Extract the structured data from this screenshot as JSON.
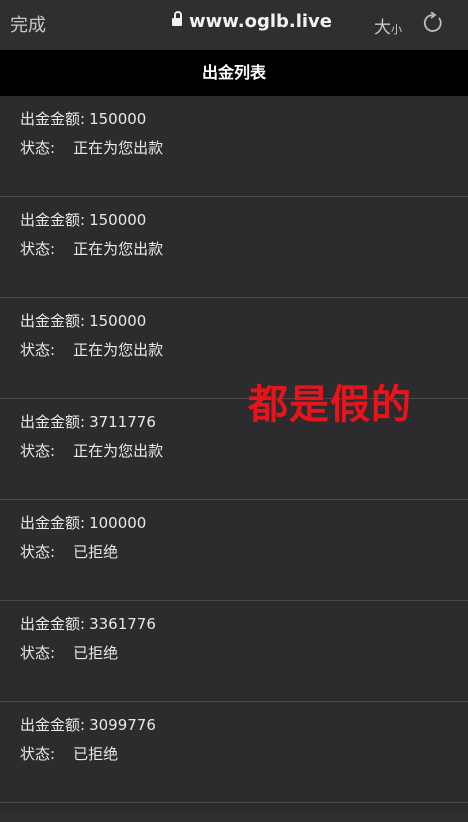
{
  "browser": {
    "done_label": "完成",
    "url": "www.oglb.live",
    "text_size_big": "大",
    "text_size_small": "小"
  },
  "page": {
    "title": "出金列表"
  },
  "list": {
    "amount_label": "出金金额:",
    "status_label": "状态:",
    "items": [
      {
        "amount": "150000",
        "status": "正在为您出款"
      },
      {
        "amount": "150000",
        "status": "正在为您出款"
      },
      {
        "amount": "150000",
        "status": "正在为您出款"
      },
      {
        "amount": "3711776",
        "status": "正在为您出款"
      },
      {
        "amount": "100000",
        "status": "已拒绝"
      },
      {
        "amount": "3361776",
        "status": "已拒绝"
      },
      {
        "amount": "3099776",
        "status": "已拒绝"
      }
    ]
  },
  "overlay_text": "都是假的",
  "colors": {
    "overlay": "#e8141b",
    "header_bg": "#000000",
    "page_bg": "#2c2c2e"
  }
}
